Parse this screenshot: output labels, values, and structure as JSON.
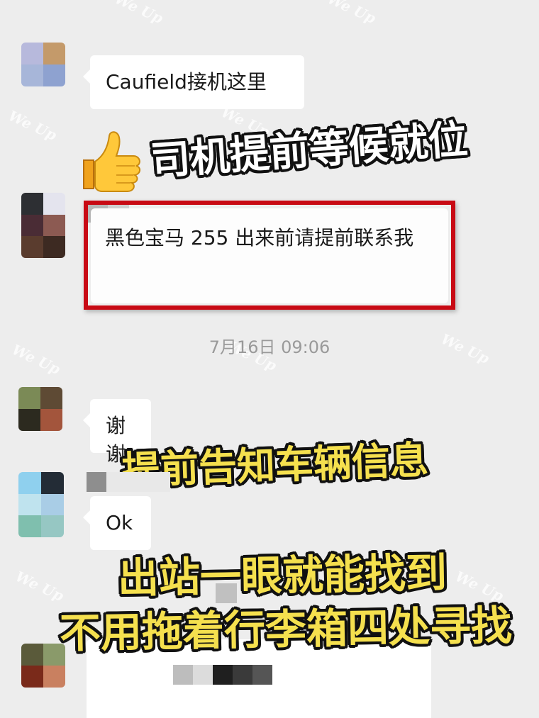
{
  "messages": [
    {
      "text": "Caufield接机这里"
    },
    {
      "text": "黑色宝马 255 出来前请提前联系我"
    },
    {
      "text": "谢谢"
    },
    {
      "text": "Ok"
    }
  ],
  "timestamp": "7月16日 09:06",
  "overlays": {
    "driver_waiting": "司机提前等候就位",
    "vehicle_info": "提前告知车辆信息",
    "find_at_exit_line1": "出站一眼就能找到",
    "find_at_exit_line2": "不用拖着行李箱四处寻找"
  },
  "thumbs_up_icon": "thumbs-up-emoji",
  "watermark_text": "We Up",
  "colors": {
    "background": "#ededed",
    "bubble": "#ffffff",
    "highlight_border": "#c80a14",
    "overlay_text": "#f5e04e",
    "timestamp": "#9a9a9a"
  }
}
